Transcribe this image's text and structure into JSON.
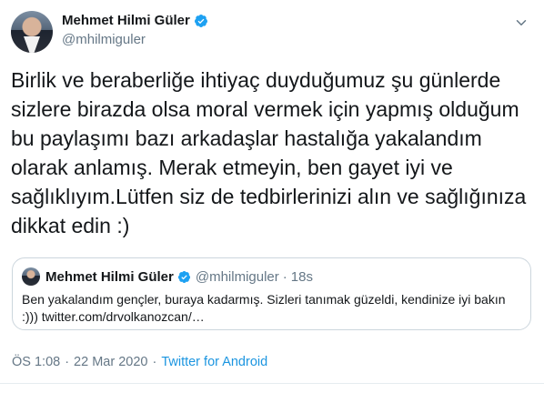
{
  "author": {
    "display_name": "Mehmet Hilmi Güler",
    "handle": "@mhilmiguler",
    "verified": true
  },
  "tweet": {
    "text": "Birlik ve beraberliğe ihtiyaç duyduğumuz şu günlerde\nsizlere birazda olsa moral vermek için yapmış olduğum\nbu paylaşımı bazı arkadaşlar hastalığa yakalandım\nolarak anlamış. Merak etmeyin, ben gayet iyi ve\nsağlıklıyım.Lütfen siz de tedbirlerinizi alın ve sağlığınıza\ndikkat edin :)"
  },
  "quoted_tweet": {
    "display_name": "Mehmet Hilmi Güler",
    "handle": "@mhilmiguler",
    "dot": "·",
    "time": "18s",
    "text": "Ben yakalandım gençler, buraya kadarmış. Sizleri tanımak güzeldi, kendinize iyi bakın :))) twitter.com/drvolkanozcan/…"
  },
  "meta": {
    "time": "ÖS 1:08",
    "separator1": "·",
    "date": "22 Mar 2020",
    "separator2": "·",
    "source": "Twitter for Android"
  },
  "colors": {
    "verified": "#1da1f2",
    "link": "#1b95e0",
    "secondary_text": "#657786",
    "border": "#ccd6dd"
  },
  "icons": [
    "verified-badge-icon",
    "caret-down-icon"
  ]
}
